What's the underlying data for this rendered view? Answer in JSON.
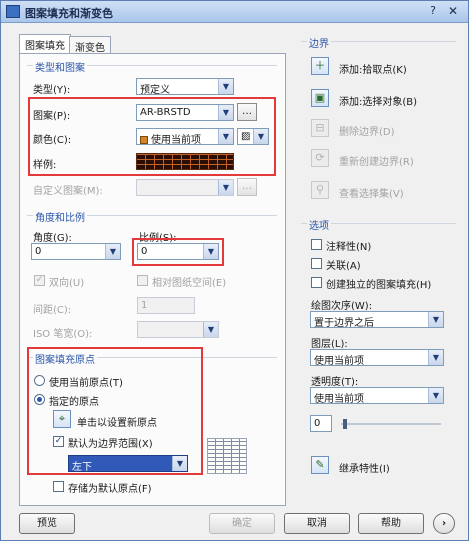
{
  "window": {
    "title": "图案填充和渐变色",
    "help_glyph": "?",
    "close_glyph": "✕"
  },
  "tabs": [
    {
      "label": "图案填充"
    },
    {
      "label": "渐变色"
    }
  ],
  "type_pattern": {
    "group_title": "类型和图案",
    "type_label": "类型(Y):",
    "type_value": "预定义",
    "pattern_label": "图案(P):",
    "pattern_value": "AR-BRSTD",
    "color_label": "颜色(C):",
    "color_value": "使用当前项",
    "color_swatch": "#d68424",
    "sample_label": "样例:",
    "custom_pattern_label": "自定义图案(M):"
  },
  "angle_scale": {
    "group_title": "角度和比例",
    "angle_label": "角度(G):",
    "angle_value": "0",
    "scale_label": "比例(S):",
    "scale_value": "0",
    "double_label": "双向(U)",
    "relative_label": "相对图纸空间(E)",
    "spacing_label": "间距(C):",
    "spacing_value": "1",
    "iso_label": "ISO 笔宽(O):"
  },
  "origin": {
    "group_title": "图案填充原点",
    "use_current_label": "使用当前原点(T)",
    "specified_label": "指定的原点",
    "click_set_label": "单击以设置新原点",
    "default_boundary_label": "默认为边界范围(X)",
    "position_value": "左下",
    "store_default_label": "存储为默认原点(F)"
  },
  "boundary": {
    "group_title": "边界",
    "add_pick_label": "添加:拾取点(K)",
    "add_select_label": "添加:选择对象(B)",
    "remove_label": "删除边界(D)",
    "recreate_label": "重新创建边界(R)",
    "view_selection_label": "查看选择集(V)"
  },
  "options": {
    "group_title": "选项",
    "annotative_label": "注释性(N)",
    "associative_label": "关联(A)",
    "separate_label": "创建独立的图案填充(H)",
    "draw_order_label": "绘图次序(W):",
    "draw_order_value": "置于边界之后",
    "layer_label": "图层(L):",
    "layer_value": "使用当前项",
    "transparency_label": "透明度(T):",
    "transparency_value": "使用当前项",
    "transparency_amount": "0"
  },
  "inherit_label": "继承特性(I)",
  "footer": {
    "preview_label": "预览",
    "ok_label": "确定",
    "cancel_label": "取消",
    "help_label": "帮助",
    "more_glyph": "›"
  },
  "highlight_color": "#e23a3a"
}
